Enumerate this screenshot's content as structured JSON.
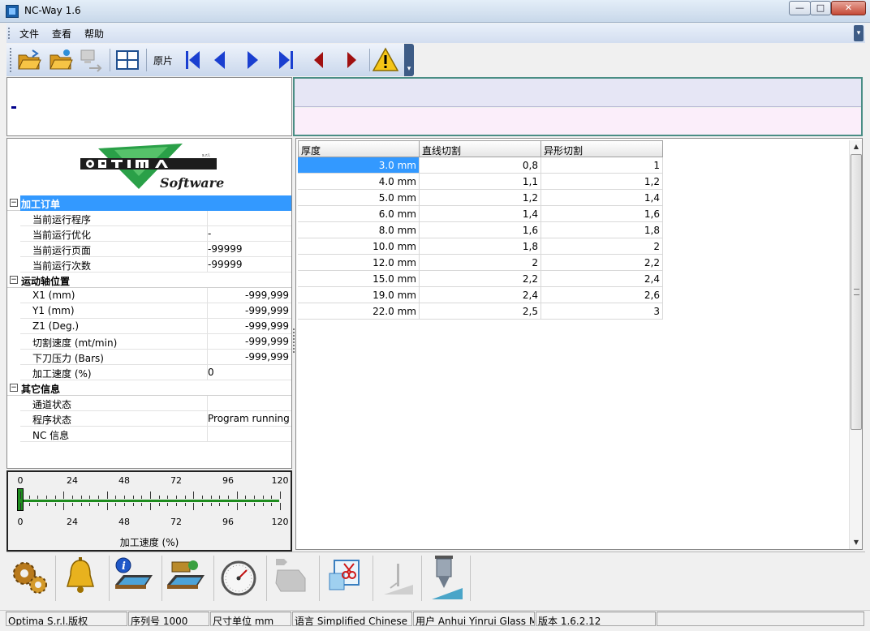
{
  "window": {
    "title": "NC-Way 1.6"
  },
  "menu": {
    "items": [
      "文件",
      "查看",
      "帮助"
    ]
  },
  "toolbar": {
    "original_label": "原片",
    "buttons": [
      "open-folder-icon",
      "open-folder-star-icon",
      "send-to-machine-icon",
      "grid-view-icon",
      "first-icon",
      "prev-icon",
      "next-icon",
      "last-icon",
      "back-red-icon",
      "forward-red-icon",
      "warning-icon"
    ],
    "colors": {
      "nav_blue": "#1a3fd0",
      "nav_red": "#a01010",
      "warning": "#f5c518"
    }
  },
  "props": {
    "groups": [
      {
        "title": "加工订单",
        "selected": true,
        "rows": [
          {
            "label": "当前运行程序",
            "value": "",
            "align": "l"
          },
          {
            "label": "当前运行优化",
            "value": "-",
            "align": "l"
          },
          {
            "label": "当前运行页面",
            "value": "-99999",
            "align": "l"
          },
          {
            "label": "当前运行次数",
            "value": "-99999",
            "align": "l"
          }
        ]
      },
      {
        "title": "运动轴位置",
        "selected": false,
        "rows": [
          {
            "label": "X1 (mm)",
            "value": "-999,999",
            "align": "r"
          },
          {
            "label": "Y1 (mm)",
            "value": "-999,999",
            "align": "r"
          },
          {
            "label": "Z1 (Deg.)",
            "value": "-999,999",
            "align": "r"
          },
          {
            "label": "切割速度 (mt/min)",
            "value": "-999,999",
            "align": "r"
          },
          {
            "label": "下刀压力 (Bars)",
            "value": "-999,999",
            "align": "r"
          },
          {
            "label": "加工速度 (%)",
            "value": "0",
            "align": "l"
          }
        ]
      },
      {
        "title": "其它信息",
        "selected": false,
        "rows": [
          {
            "label": "通道状态",
            "value": "",
            "align": "l"
          },
          {
            "label": "程序状态",
            "value": "Program running",
            "align": "l"
          },
          {
            "label": "NC 信息",
            "value": "",
            "align": "l"
          }
        ]
      }
    ]
  },
  "gauge": {
    "title": "加工速度 (%)",
    "ticks": [
      "0",
      "24",
      "48",
      "72",
      "96",
      "120"
    ],
    "value": 0,
    "max": 120,
    "color": "#1e8c1e"
  },
  "grid": {
    "headers": [
      "厚度",
      "直线切割",
      "异形切割"
    ],
    "rows": [
      [
        "3.0 mm",
        "0,8",
        "1"
      ],
      [
        "4.0 mm",
        "1,1",
        "1,2"
      ],
      [
        "5.0 mm",
        "1,2",
        "1,4"
      ],
      [
        "6.0 mm",
        "1,4",
        "1,6"
      ],
      [
        "8.0 mm",
        "1,6",
        "1,8"
      ],
      [
        "10.0 mm",
        "1,8",
        "2"
      ],
      [
        "12.0 mm",
        "2",
        "2,2"
      ],
      [
        "15.0 mm",
        "2,2",
        "2,4"
      ],
      [
        "19.0 mm",
        "2,4",
        "2,6"
      ],
      [
        "22.0 mm",
        "2,5",
        "3"
      ]
    ],
    "selected_row": 0
  },
  "bottom_icons": [
    "gears-icon",
    "bell-icon",
    "machine-info-icon",
    "machine-table-icon",
    "gauge-icon",
    "machine-disabled-icon",
    "cut-file-icon",
    "blade-disabled-icon",
    "cutting-head-icon"
  ],
  "status": {
    "cells": [
      "Optima S.r.l.版权",
      "序列号 1000",
      "尺寸单位 mm",
      "语言 Simplified Chinese",
      "用户 Anhui Yinrui Glass Ma",
      "版本 1.6.2.12",
      ""
    ]
  }
}
